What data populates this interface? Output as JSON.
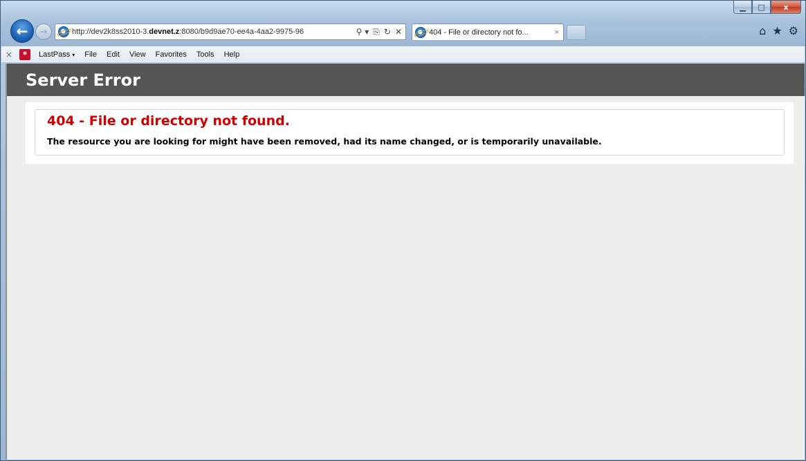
{
  "browser": {
    "url_prefix": "http://dev2k8ss2010-3.",
    "url_domain": "devnet.z",
    "url_suffix": ":8080/b9d9ae70-ee4a-4aa2-9975-96",
    "tab_title": "404 - File or directory not fo...",
    "tab_close": "×",
    "addr_tools": [
      "⚲ ▾",
      "⎘",
      "↻",
      "✕"
    ],
    "icons": [
      "home-icon",
      "favorites-icon",
      "tools-gear-icon"
    ]
  },
  "window_controls": {
    "minimize": "▁",
    "maximize": "□",
    "close": "x"
  },
  "menubar": {
    "close": "×",
    "lastpass_label": "LastPass",
    "lastpass_caret": "▾",
    "items": [
      "File",
      "Edit",
      "View",
      "Favorites",
      "Tools",
      "Help"
    ]
  },
  "page": {
    "header": "Server Error",
    "error_title": "404 - File or directory not found.",
    "error_description": "The resource you are looking for might have been removed, had its name changed, or is temporarily unavailable."
  },
  "colors": {
    "header_bg": "#555555",
    "error_red": "#cc0000",
    "content_bg": "#eeeeee"
  }
}
